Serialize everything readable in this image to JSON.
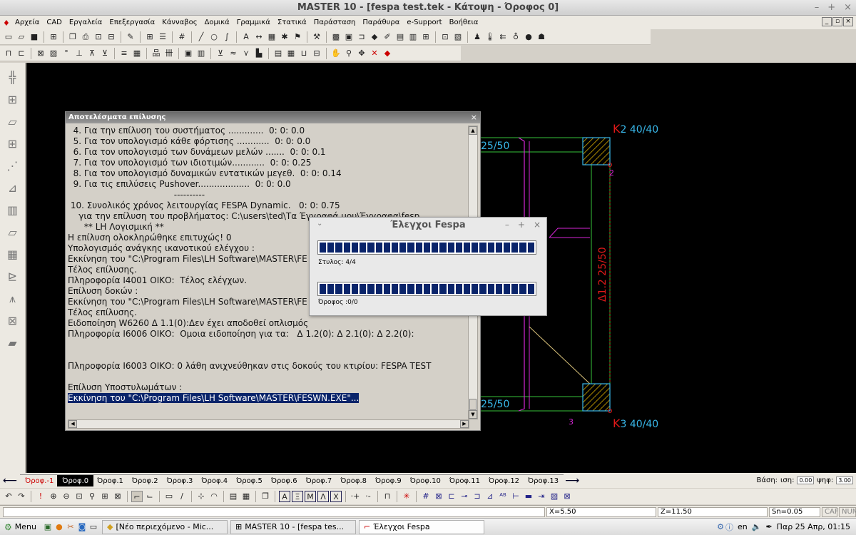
{
  "window": {
    "title": "MASTER 10 - [fespa test.tek - Κάτοψη - Όροφος 0]",
    "controls": [
      "–",
      "+",
      "×"
    ]
  },
  "menu": [
    "Αρχεία",
    "CAD",
    "Εργαλεία",
    "Επεξεργασία",
    "Κάνναβος",
    "Δομικά",
    "Γραμμικά",
    "Στατικά",
    "Παράσταση",
    "Παράθυρα",
    "e-Support",
    "Βοήθεια"
  ],
  "mdi_controls": [
    "_",
    "▫",
    "×"
  ],
  "result_window": {
    "title": "Αποτελέσματα επίλυσης",
    "lines": [
      "  4. Για την επίλυση του συστήματος .............  0: 0: 0.0",
      "  5. Για τον υπολογισμό κάθε φόρτισης ............  0: 0: 0.0",
      "  6. Για τον υπολογισμό των δυνάμεων μελών .......  0: 0: 0.1",
      "  7. Για τον υπολογισμό των ιδιοτιμών............  0: 0: 0.25",
      "  8. Για τον υπολογισμό δυναμικών εντατικών μεγεθ.  0: 0: 0.14",
      "  9. Για τις επιλύσεις Pushover...................  0: 0: 0.0",
      "                                       ----------",
      " 10. Συνολικός χρόνος λειτουργίας FESPA Dynamic.   0: 0: 0.75",
      "    για την επίλυση του προβλήματος: C:\\users\\ted\\Τα Έγγραφά μου\\Έγγραφα\\fesp",
      "      ** LH Λογισμική **",
      "Η επίλυση ολοκληρώθηκε επιτυχώς! 0",
      "Υπολογισμός ανάγκης ικανοτικού ελέγχου :",
      "Εκκίνηση του \"C:\\Program Files\\LH Software\\MASTER\\FE",
      "Τέλος επίλυσης.",
      "Πληροφορία I4001 ΟΙΚΟ:  Τέλος ελέγχων.",
      "Επίλυση δοκών :",
      "Εκκίνηση του \"C:\\Program Files\\LH Software\\MASTER\\FE",
      "Τέλος επίλυσης.",
      "Ειδοποίηση W6260 Δ 1.1(0):Δεν έχει αποδοθεί οπλισμός",
      "Πληροφορία I6006 ΟΙΚΟ:  Ομοια ειδοποίηση για τα:   Δ 1.2(0): Δ 2.1(0): Δ 2.2(0):",
      "",
      "",
      "Πληροφορία I6003 ΟΙΚΟ: 0 λάθη ανιχνεύθηκαν στις δοκούς του κτιρίου: FESPA TEST",
      "",
      "Επίλυση Υποστυλωμάτων :",
      "Εκκίνηση του \"C:\\Program Files\\LH Software\\MASTER\\FESWN.EXE\"..."
    ],
    "close_symbol": "×"
  },
  "fespa_dialog": {
    "title": "Έλεγχοι Fespa",
    "menu_symbol": "⌄",
    "controls": [
      "–",
      "+",
      "×"
    ],
    "bar1": {
      "label": "Στυλος:  4/4",
      "progress": 1.0
    },
    "bar2": {
      "label": "Όροφος :0/0",
      "progress": 1.0
    }
  },
  "plan": {
    "col_top": "K2 40/40",
    "col_top_prefix": "K",
    "col_top_rest": "2 40/40",
    "col_bottom_prefix": "K",
    "col_bottom_rest": "3 40/40",
    "beam_top": "25/50",
    "beam_bottom": "25/50",
    "beam_vertical": "Δ1.2  25/50",
    "node_2": "2",
    "node_3": "3"
  },
  "floor_tabs": [
    "Όροφ.-1",
    "Όροφ.0",
    "Όροφ.1",
    "Όροφ.2",
    "Όροφ.3",
    "Όροφ.4",
    "Όροφ.5",
    "Όροφ.6",
    "Όροφ.7",
    "Όροφ.8",
    "Όροφ.9",
    "Όροφ.10",
    "Όροφ.11",
    "Όροφ.12",
    "Όροφ.13"
  ],
  "floor_tab_active": 1,
  "floor_info": {
    "basis_label": "Βάση:",
    "isi_label": "ιση:",
    "isi_value": "0.00",
    "ypsi_label": "ψηφ:",
    "ypsi_value": "3.00"
  },
  "status": {
    "x": "X=5.50",
    "z": "Z=11.50",
    "sn": "Sn=0.05",
    "caf": "CAF",
    "num": "NUM"
  },
  "taskbar": {
    "menu": "Menu",
    "tasks": [
      "[Νέο περιεχόμενο - Mic...",
      "MASTER 10 - [fespa tes...",
      "Έλεγχοι Fespa"
    ],
    "lang": "en",
    "clock": "Παρ 25 Απρ, 01:15"
  },
  "colors": {
    "canvas": "#000000",
    "grid_green": "#36c23a",
    "magenta": "#d426d4",
    "column_yellow": "#e6b700",
    "cyan": "#38b6e8",
    "red": "#e01818",
    "progress": "#0a246a"
  }
}
